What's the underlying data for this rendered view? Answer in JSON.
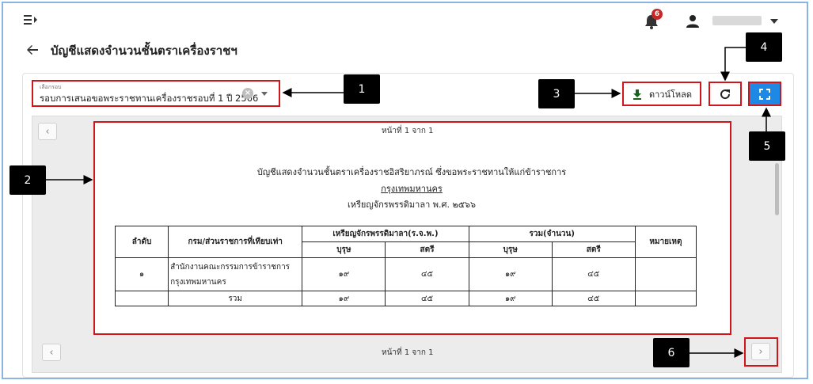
{
  "header": {
    "notification_count": "6",
    "page_title": "บัญชีแสดงจำนวนชั้นตราเครื่องราชฯ"
  },
  "filter": {
    "label": "เลือกรอบ",
    "value": "รอบการเสนอขอพระราชทานเครื่องราชรอบที่ 1  ปี 2566"
  },
  "toolbar": {
    "download_label": "ดาวน์โหลด"
  },
  "viewer": {
    "page_indicator": "หน้าที่ 1 จาก 1",
    "document": {
      "title_line_1": "บัญชีแสดงจำนวนชั้นตราเครื่องราชอิสริยาภรณ์ ซึ่งขอพระราชทานให้แก่ข้าราชการ",
      "title_line_2": "กรุงเทพมหานคร",
      "title_line_3": "เหรียญจักรพรรดิมาลา พ.ศ. ๒๕๖๖",
      "table": {
        "headers": {
          "seq": "ลำดับ",
          "org": "กรม/ส่วนราชการที่เทียบเท่า",
          "medal": "เหรียญจักรพรรดิมาลา(ร.จ.พ.)",
          "total": "รวม(จำนวน)",
          "remark": "หมายเหตุ",
          "male": "บุรุษ",
          "female": "สตรี"
        },
        "row": {
          "seq": "๑",
          "org": "สำนักงานคณะกรรมการข้าราชการกรุงเทพมหานคร",
          "medal_male": "๑๙",
          "medal_female": "๔๕",
          "total_male": "๑๙",
          "total_female": "๔๕",
          "remark": ""
        },
        "total_row": {
          "label": "รวม",
          "medal_male": "๑๙",
          "medal_female": "๔๕",
          "total_male": "๑๙",
          "total_female": "๔๕"
        }
      }
    }
  },
  "callouts": [
    "1",
    "2",
    "3",
    "4",
    "5",
    "6"
  ]
}
